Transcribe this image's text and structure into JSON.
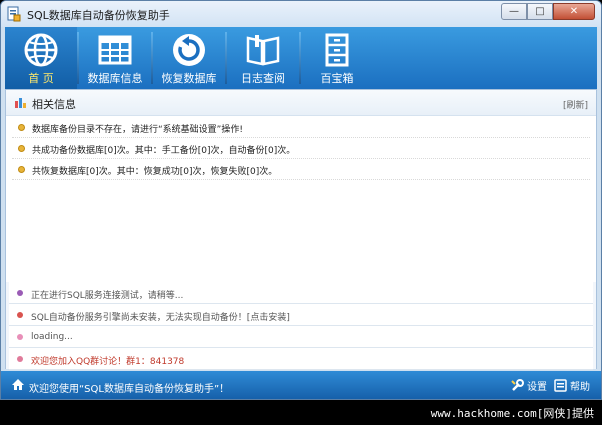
{
  "window": {
    "title": "SQL数据库自动备份恢复助手"
  },
  "toolbar": {
    "items": [
      {
        "label": "首 页",
        "icon": "globe-icon"
      },
      {
        "label": "数据库信息",
        "icon": "database-grid-icon"
      },
      {
        "label": "恢复数据库",
        "icon": "restore-icon"
      },
      {
        "label": "日志查阅",
        "icon": "book-icon"
      },
      {
        "label": "百宝箱",
        "icon": "cabinet-icon"
      }
    ]
  },
  "panel": {
    "title": "相关信息",
    "refresh": "[刷新]",
    "messages": [
      "数据库备份目录不存在，请进行“系统基础设置”操作!",
      "共成功备份数据库[0]次。其中：手工备份[0]次，自动备份[0]次。",
      "共恢复数据库[0]次。其中：恢复成功[0]次，恢复失败[0]次。"
    ]
  },
  "status": [
    {
      "text": "正在进行SQL服务连接测试，请稍等...",
      "color": "#555555",
      "dot": "#9a5bb5"
    },
    {
      "text": "SQL自动备份服务引擎尚未安装，无法实现自动备份！[点击安装]",
      "color": "#555555",
      "dot": "#d9534f"
    },
    {
      "text": "loading...",
      "color": "#555555",
      "dot": "#e88fb8"
    },
    {
      "text": "欢迎您加入QQ群讨论！群1：841378",
      "color": "#c0392b",
      "dot": "#e07a9a"
    }
  ],
  "footer": {
    "welcome": "欢迎您使用“SQL数据库自动备份恢复助手”！",
    "settings": "设置",
    "help": "帮助"
  },
  "watermark": "www.hackhome.com[网侠]提供",
  "colors": {
    "toolbar": "#1b6fc0",
    "accent": "#2f8bd6"
  }
}
